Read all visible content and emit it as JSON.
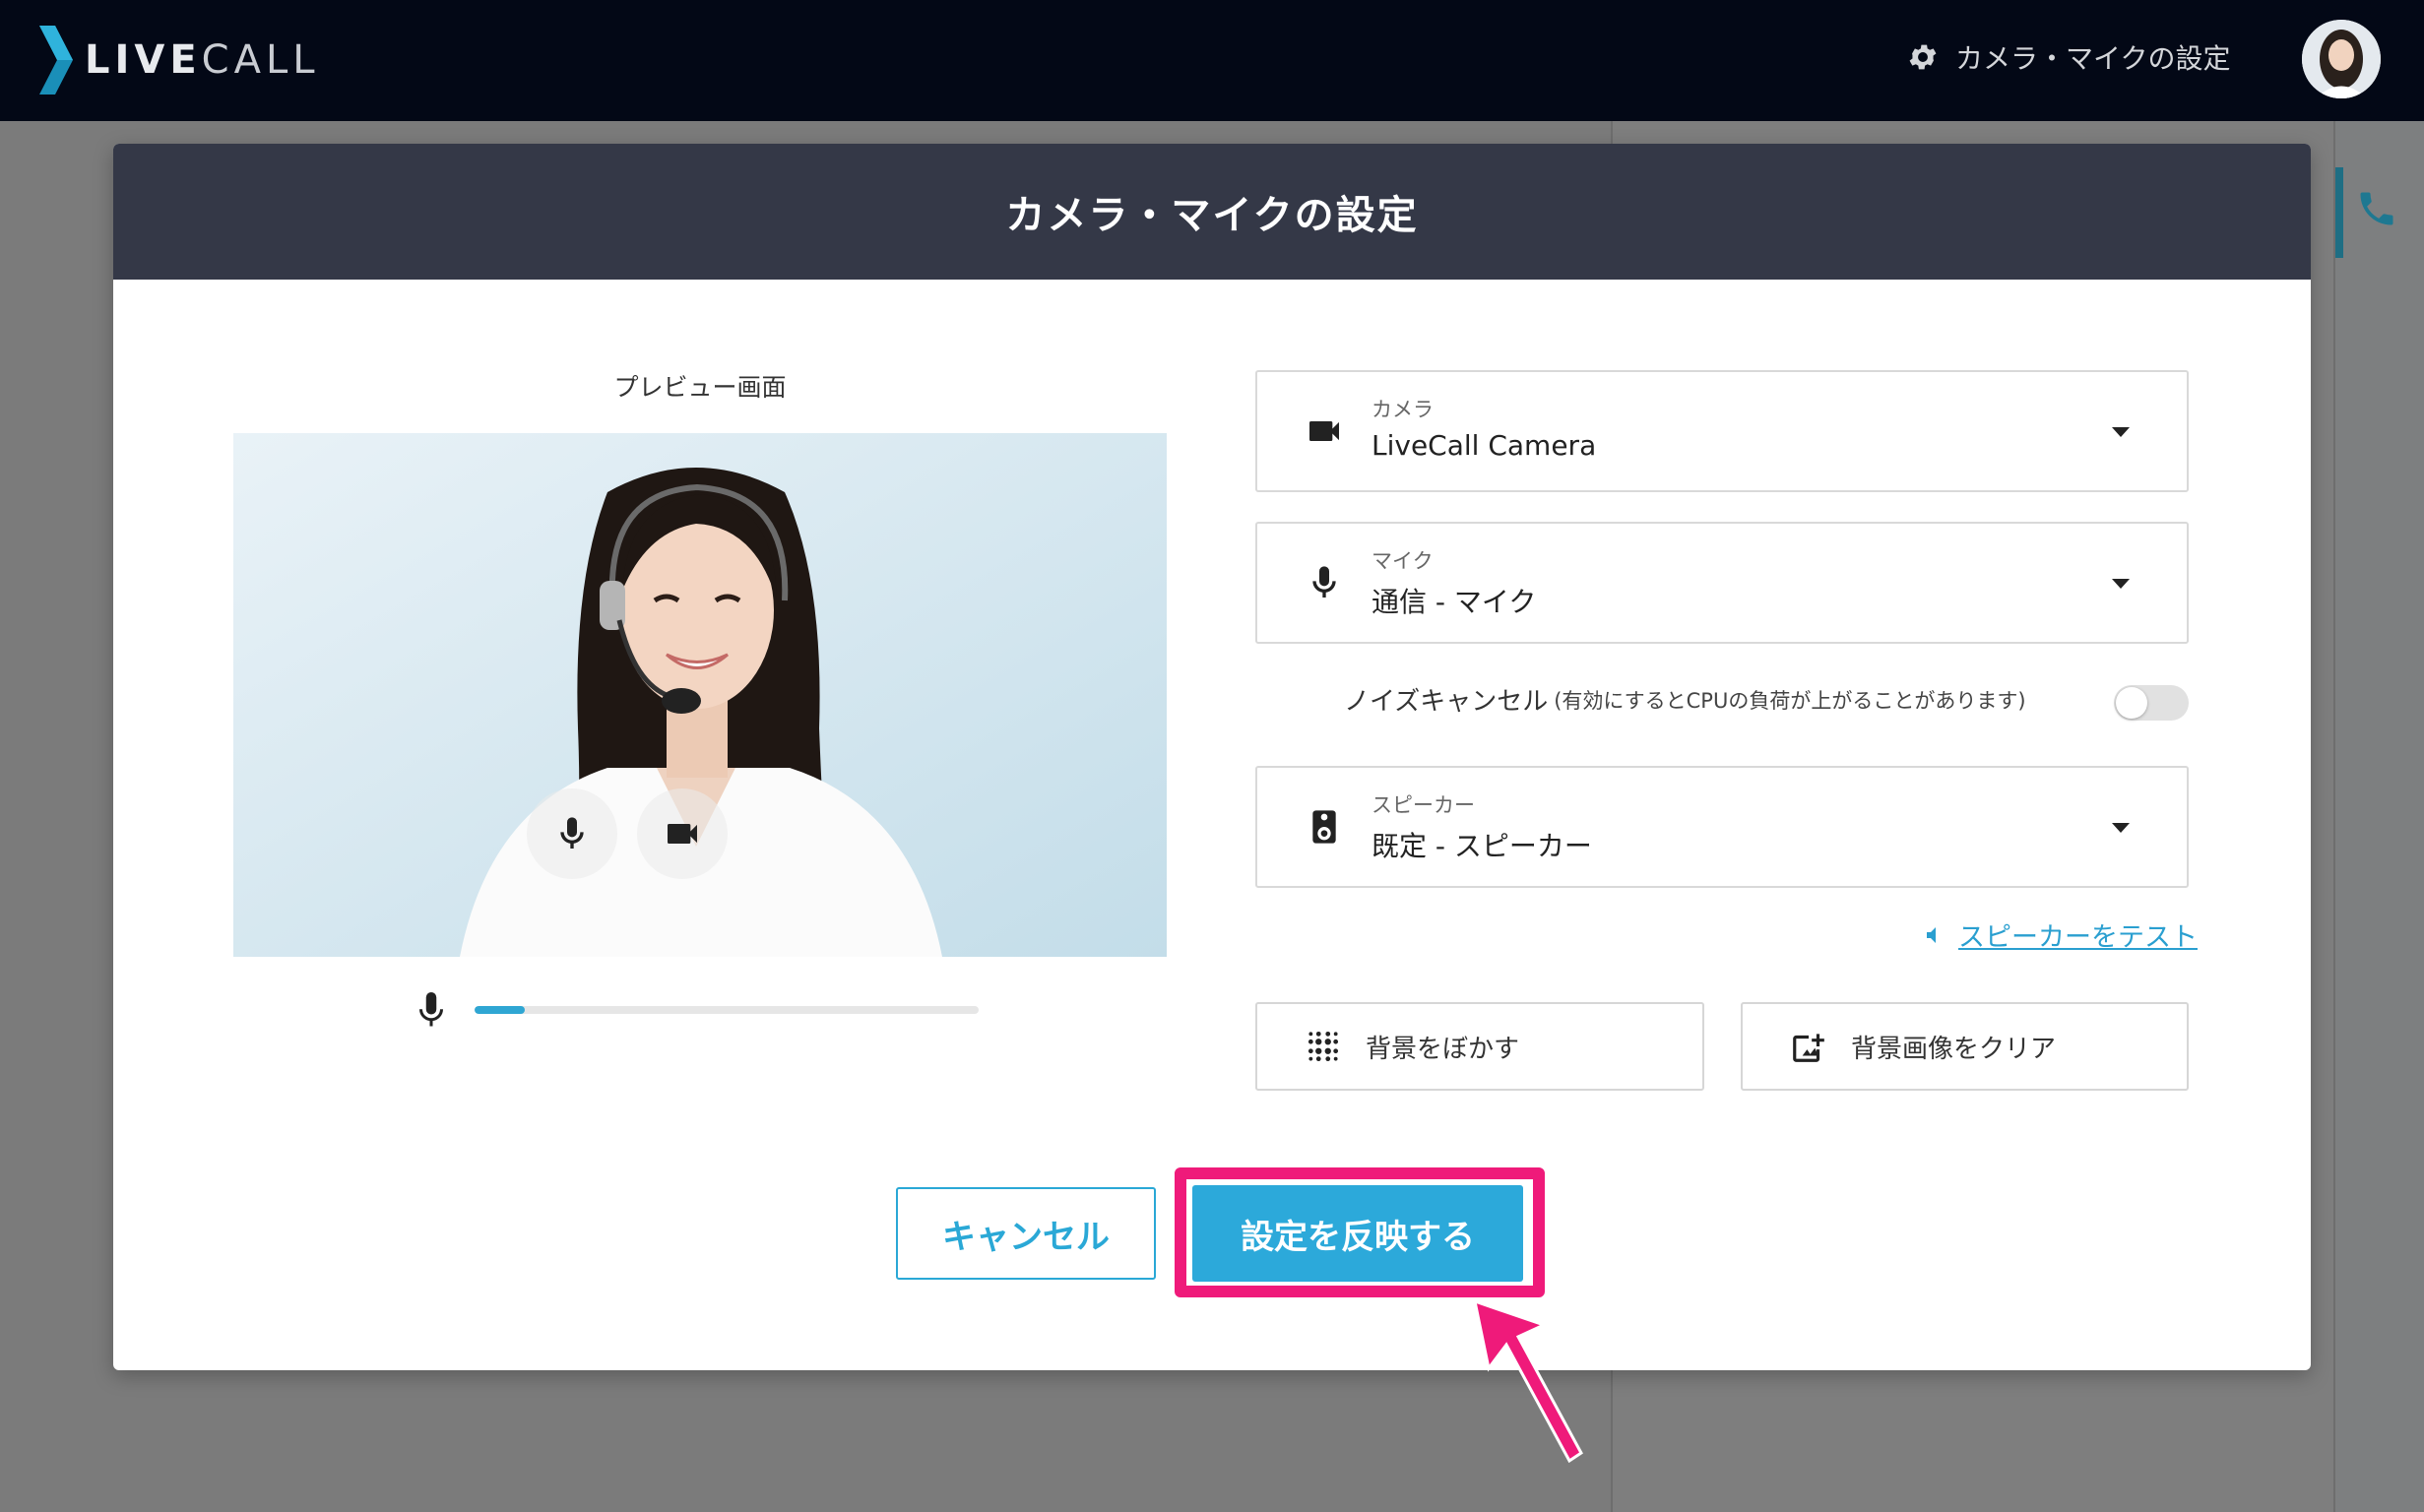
{
  "app": {
    "logo_text_bold": "LIVE",
    "logo_text_light": "CALL",
    "header_settings_label": "カメラ・マイクの設定"
  },
  "modal": {
    "title": "カメラ・マイクの設定",
    "preview_label": "プレビュー画面",
    "mic_level": 0.1,
    "camera": {
      "label": "カメラ",
      "value": "LiveCall Camera"
    },
    "mic": {
      "label": "マイク",
      "value": "通信 - マイク"
    },
    "noise_cancel": {
      "label": "ノイズキャンセル",
      "note": "(有効にするとCPUの負荷が上がることがあります)",
      "enabled": false
    },
    "speaker": {
      "label": "スピーカー",
      "value": "既定 - スピーカー"
    },
    "speaker_test_label": "スピーカーをテスト",
    "blur_button_label": "背景をぼかす",
    "clear_bg_button_label": "背景画像をクリア",
    "cancel_label": "キャンセル",
    "apply_label": "設定を反映する"
  },
  "colors": {
    "accent": "#2ca9da",
    "highlight": "#ef1a7a",
    "header_bg": "#030816",
    "modal_header_bg": "#343847"
  }
}
